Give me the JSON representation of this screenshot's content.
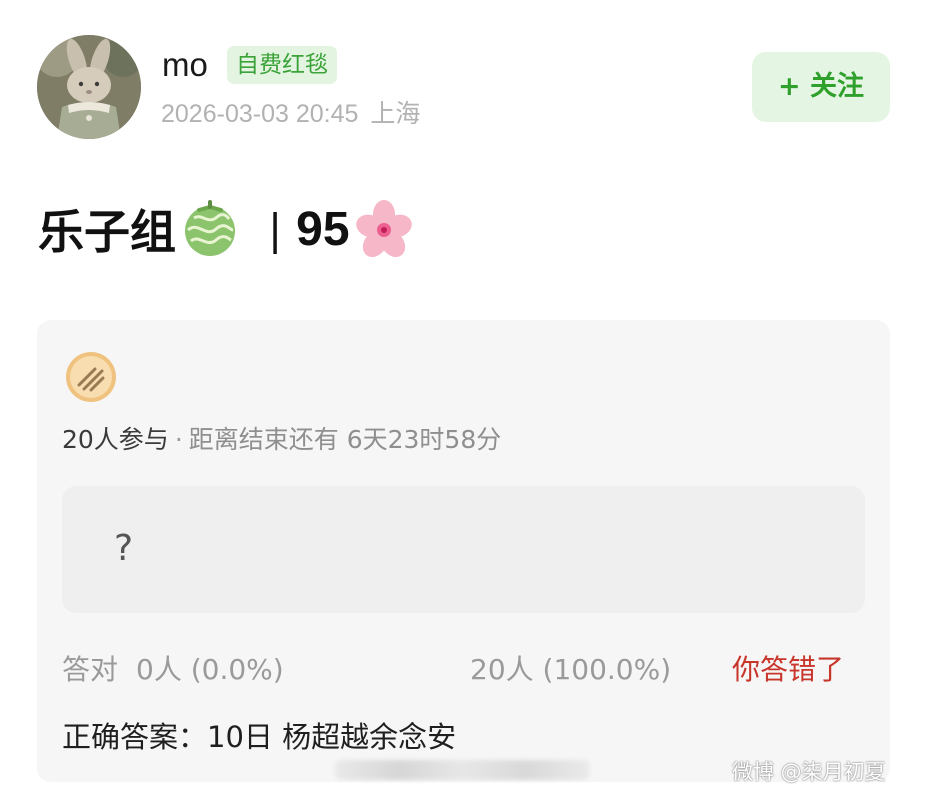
{
  "post": {
    "username": "mo",
    "badge": "自费红毯",
    "timestamp": "2026-03-03 20:45",
    "location": "上海",
    "follow_label": "+ 关注",
    "title": "乐子组",
    "title_separator": "|",
    "title_number": "95",
    "title_icons": [
      "melon-emoji-icon",
      "cherry-blossom-emoji-icon"
    ]
  },
  "quiz": {
    "icon": "quiz-card-icon",
    "participants": "20人参与",
    "dot": "·",
    "remaining": "距离结束还有 6天23时58分",
    "option_text": "?",
    "correct_label": "答对",
    "correct_count": "0人 (0.0%)",
    "wrong_count": "20人 (100.0%)",
    "user_result": "你答错了",
    "answer_text": "正确答案：10日 杨超越余念安"
  },
  "watermark": "微博 @柒月初夏",
  "colors": {
    "accent_green": "#3ca33a",
    "wrong_red": "#c7352b"
  }
}
